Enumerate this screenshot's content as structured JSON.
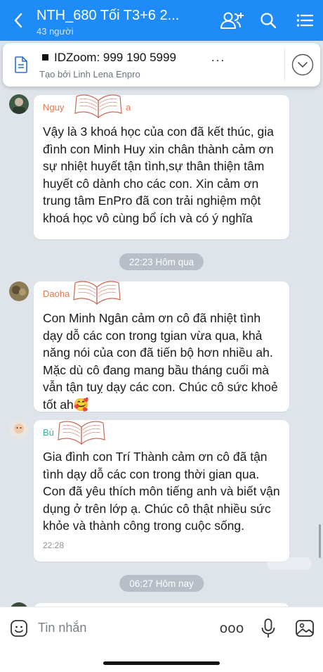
{
  "header": {
    "title": "NTH_680 Tối T3+6 2...",
    "subtitle": "43 người",
    "icons": [
      "back-icon",
      "add-member-icon",
      "search-icon",
      "menu-icon"
    ]
  },
  "pinned": {
    "title": "IDZoom: 999 190 5999",
    "more": "...",
    "subtitle": "Tạo bởi Linh Lena Enpro"
  },
  "messages": [
    {
      "sender": "Nguy",
      "sender_tail": "a",
      "sender_color": "#e8764a",
      "text": "Vậy là 3 khoá học của con đã kết thúc, gia đình con Minh Huy xin chân thành cảm ơn sự nhiệt huyết tận tình,sự thân thiện tâm huyết cô dành cho các con. Xin cảm ơn trung tâm EnPro đã con trải nghiệm một khoá học vô cùng bổ ích và có ý nghĩa",
      "time": ""
    },
    {
      "sender": "Daoha",
      "sender_tail": "",
      "sender_color": "#e8764a",
      "text": "Con Minh Ngân cảm ơn cô đã nhiệt tình dạy dỗ các con trong tgian vừa qua, khả năng nói của con đã tiến bộ hơn nhiều ah. Mặc dù cô đang mang bầu tháng cuối mà vẫn tận tuỵ dạy các con. Chúc cô sức khoẻ tốt ah🥰",
      "time": ""
    },
    {
      "sender": "Bù",
      "sender_tail": "",
      "sender_color": "#2eb3a5",
      "text": "Gia đình con Trí Thành cảm ơn cô đã tận tình dạy dỗ các con trong thời gian qua. Con đã yêu thích môn tiếng anh và biết vận dụng ở trên lớp ạ.  Chúc cô thật nhiều sức khỏe và thành công trong cuộc sống.",
      "time": "22:28"
    }
  ],
  "separators": [
    "22:23 Hôm qua",
    "06:27 Hôm nay"
  ],
  "input": {
    "placeholder": "Tin nhắn",
    "more": "ooo"
  },
  "colors": {
    "header_bg": "#1f8bf6",
    "chat_bg": "#dfe4eb",
    "pill_bg": "#b7bec8"
  }
}
